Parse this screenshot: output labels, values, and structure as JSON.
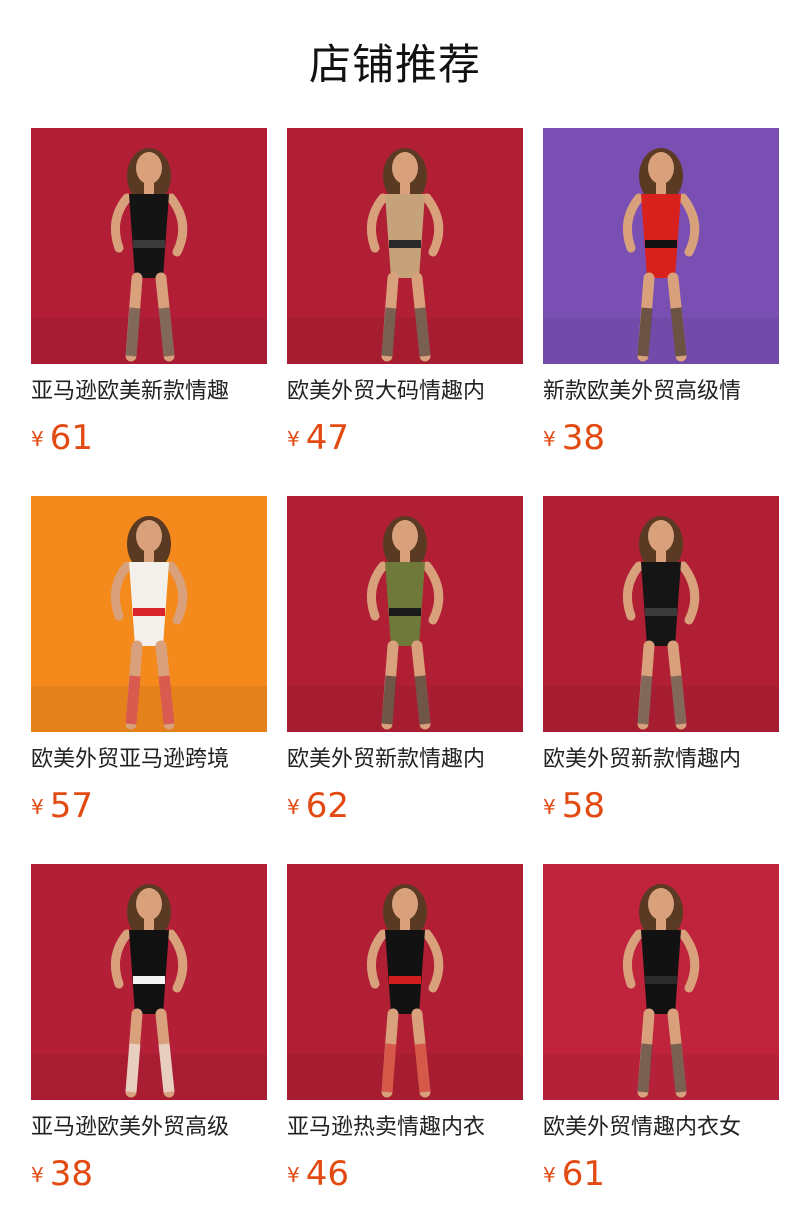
{
  "header": {
    "title": "店铺推荐"
  },
  "products": [
    {
      "name": "亚马逊欧美新款情趣",
      "currency": "¥",
      "price": "61",
      "bg": "#b21e36",
      "outfit": "#141414",
      "accent": "#3a3a3a"
    },
    {
      "name": "欧美外贸大码情趣内",
      "currency": "¥",
      "price": "47",
      "bg": "#b11f35",
      "outfit": "#c6a27a",
      "accent": "#2a2a2a"
    },
    {
      "name": "新款欧美外贸高级情",
      "currency": "¥",
      "price": "38",
      "bg": "#7a4fb4",
      "outfit": "#d8201c",
      "accent": "#121212"
    },
    {
      "name": "欧美外贸亚马逊跨境",
      "currency": "¥",
      "price": "57",
      "bg": "#f48a1c",
      "outfit": "#f4f1ec",
      "accent": "#d9232a"
    },
    {
      "name": "欧美外贸新款情趣内",
      "currency": "¥",
      "price": "62",
      "bg": "#b11f35",
      "outfit": "#6f7a3a",
      "accent": "#1a1a1a"
    },
    {
      "name": "欧美外贸新款情趣内",
      "currency": "¥",
      "price": "58",
      "bg": "#b11f35",
      "outfit": "#151515",
      "accent": "#3b3b3b"
    },
    {
      "name": "亚马逊欧美外贸高级",
      "currency": "¥",
      "price": "38",
      "bg": "#b31f36",
      "outfit": "#111111",
      "accent": "#f4f4f4"
    },
    {
      "name": "亚马逊热卖情趣内衣",
      "currency": "¥",
      "price": "46",
      "bg": "#b11f35",
      "outfit": "#121212",
      "accent": "#d11d1d"
    },
    {
      "name": "欧美外贸情趣内衣女",
      "currency": "¥",
      "price": "61",
      "bg": "#c0243c",
      "outfit": "#121212",
      "accent": "#2b2b2b"
    }
  ]
}
